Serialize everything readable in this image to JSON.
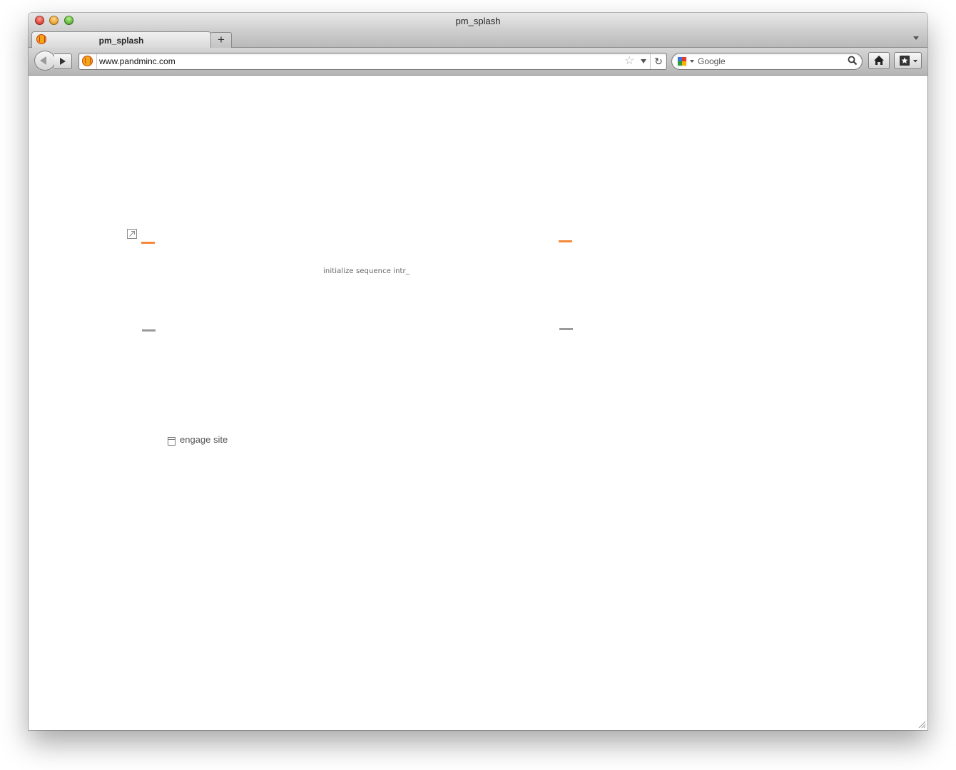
{
  "window": {
    "title": "pm_splash"
  },
  "tabs": [
    {
      "label": "pm_splash",
      "active": true
    }
  ],
  "tabstrip": {
    "new_tab_label": "+"
  },
  "navbar": {
    "url": "www.pandminc.com",
    "search_engine": "Google",
    "reload_glyph": "↻",
    "star_glyph": "☆"
  },
  "page": {
    "status_text": "initialize sequence intr_",
    "engage_label": "engage site",
    "accent_color": "#f7883c",
    "muted_color": "#9a9a9a"
  }
}
